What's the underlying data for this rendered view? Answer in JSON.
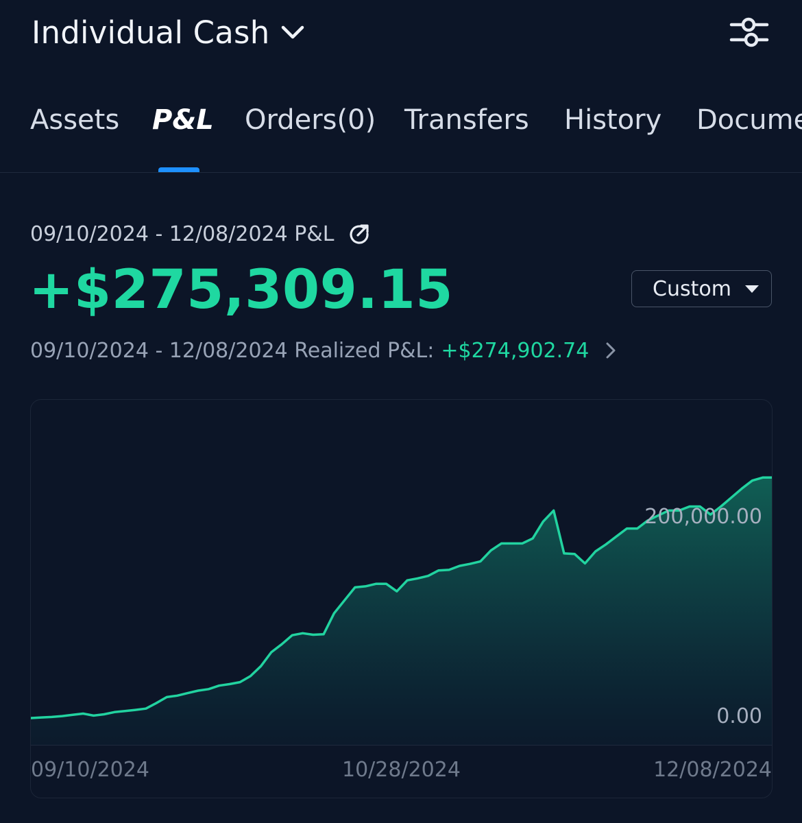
{
  "header": {
    "account_title": "Individual Cash",
    "icons": {
      "account_dropdown": "chevron-down-icon",
      "settings": "sliders-icon"
    }
  },
  "tabs": [
    {
      "label": "Assets",
      "active": false
    },
    {
      "label": "P&L",
      "active": true
    },
    {
      "label": "Orders(0)",
      "active": false
    },
    {
      "label": "Transfers",
      "active": false
    },
    {
      "label": "History",
      "active": false
    },
    {
      "label": "Documents",
      "active": false
    }
  ],
  "summary": {
    "range_title": "09/10/2024 - 12/08/2024 P&L",
    "total_pl": "+$275,309.15",
    "period_selector": "Custom",
    "realized_label": "09/10/2024 - 12/08/2024 Realized P&L:",
    "realized_value": "+$274,902.74"
  },
  "colors": {
    "background": "#0c1527",
    "positive": "#1fd8a1",
    "line": "#22d3a0",
    "tab_indicator": "#1e90ff"
  },
  "chart_data": {
    "type": "area",
    "y_tick_labels": [
      "200,000.00",
      "0.00"
    ],
    "x_tick_labels": [
      "09/10/2024",
      "10/28/2024",
      "12/08/2024"
    ],
    "ylim": [
      0,
      275309.15
    ],
    "grid": false,
    "series": [
      {
        "values": [
          0,
          600,
          1100,
          2000,
          3200,
          4500,
          2500,
          3800,
          6000,
          7000,
          8200,
          9500,
          15000,
          21000,
          22500,
          25000,
          27500,
          29000,
          32500,
          34000,
          36000,
          42000,
          52000,
          66000,
          74000,
          83000,
          85000,
          83500,
          84000,
          105000,
          118000,
          131000,
          132000,
          134500,
          134500,
          127000,
          138000,
          140000,
          142500,
          148000,
          148500,
          152500,
          154500,
          157000,
          168000,
          175000,
          175000,
          175000,
          180000,
          197000,
          208000,
          165000,
          164500,
          155000,
          167000,
          174000,
          182000,
          190000,
          190000,
          198000,
          203000,
          208000,
          208000,
          212000,
          212000,
          204000,
          212000,
          221000,
          230000,
          238000,
          241000,
          241000
        ]
      }
    ]
  }
}
